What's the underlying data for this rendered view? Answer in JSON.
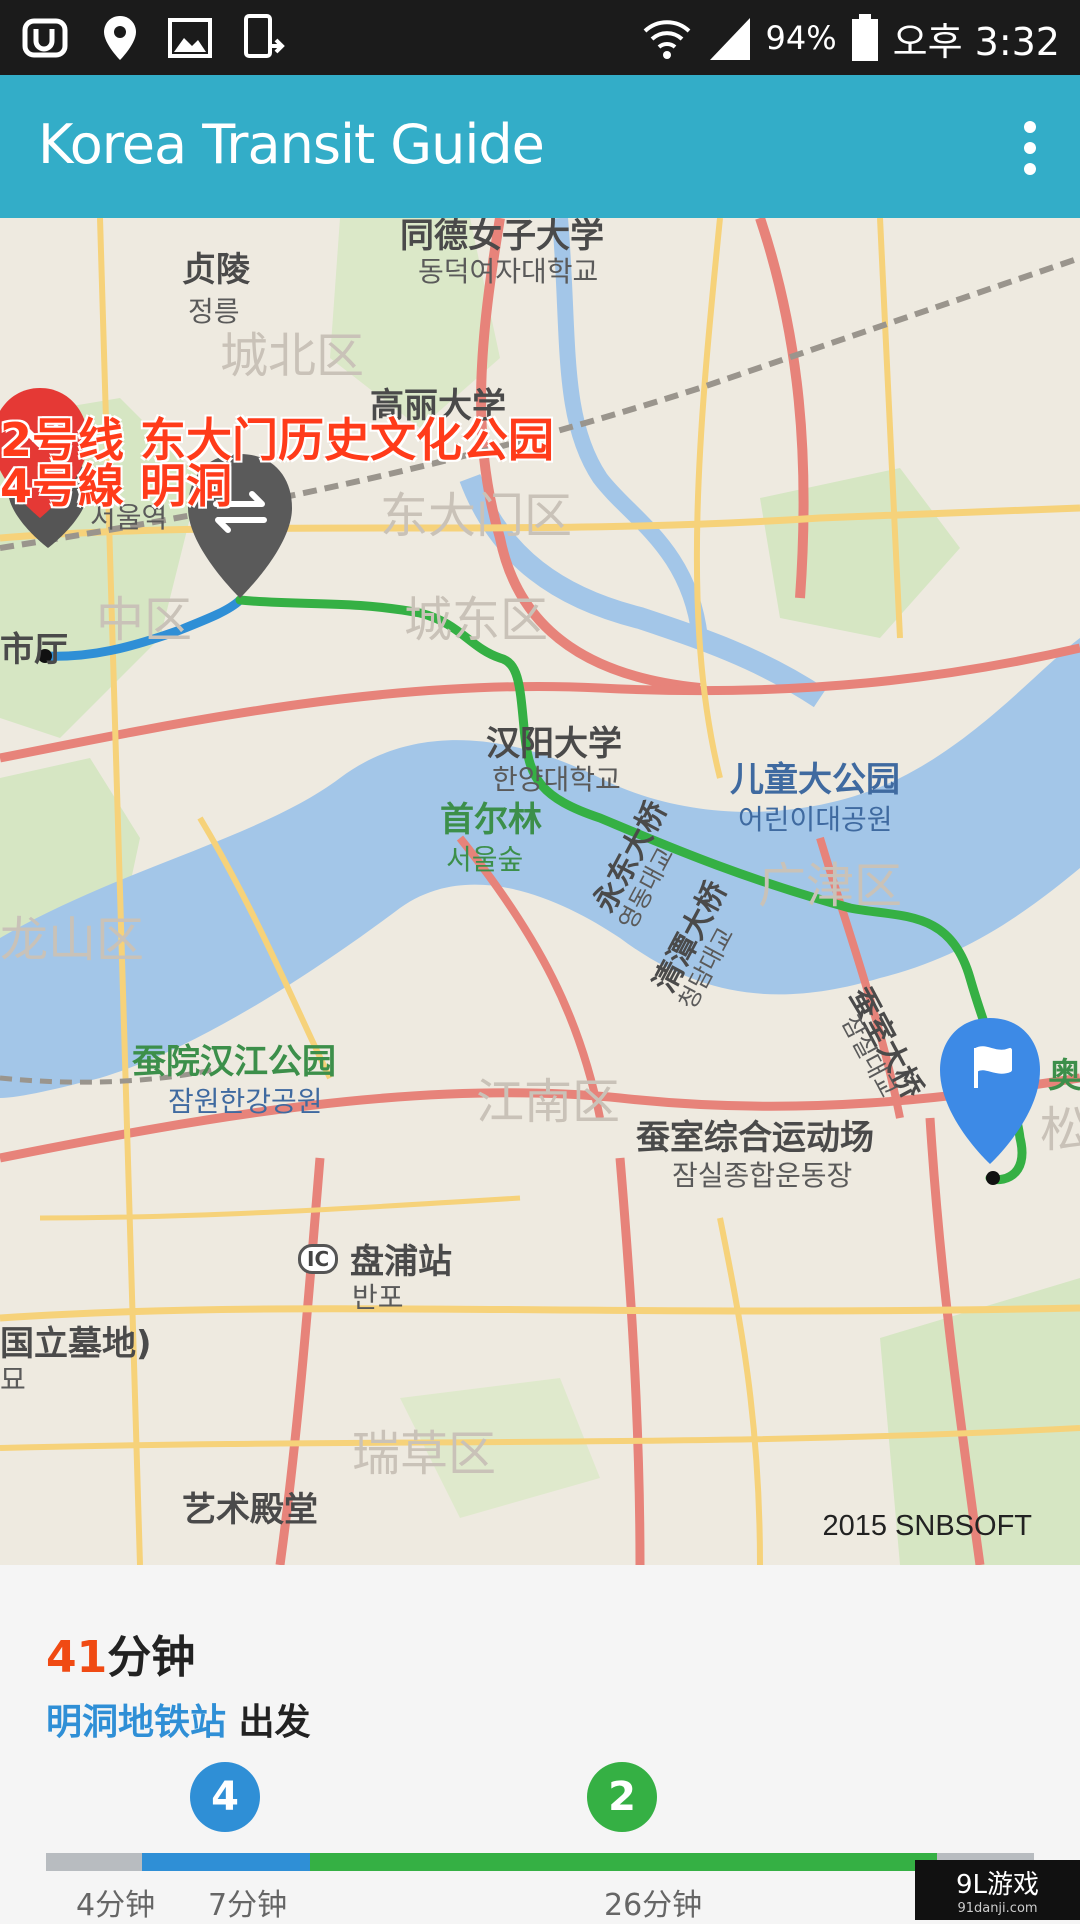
{
  "status_bar": {
    "battery": "94%",
    "time": "오후 3:32",
    "left_icons": [
      "app-icon",
      "location-icon",
      "gallery-icon",
      "phone-transfer-icon"
    ],
    "right_icons": [
      "wifi-icon",
      "signal-icon",
      "battery-icon"
    ]
  },
  "app_bar": {
    "title": "Korea Transit Guide",
    "menu_icon": "overflow-menu-icon"
  },
  "map": {
    "overlay_line1": "2号线 东大门历史文化公园",
    "overlay_line2": "4号線 明洞",
    "copyright": "2015 SNBSOFT",
    "labels": {
      "zhenling_cn": "贞陵",
      "zhenling_kr": "정릉",
      "dongduk_cn": "同德女子大学",
      "dongduk_kr": "동덕여자대학교",
      "seongbuk": "城北区",
      "korea_univ": "高丽大学",
      "dongdaemun": "东大门区",
      "seoul_station_kr": "서울역",
      "jung_gu": "中区",
      "seongdong": "城东区",
      "station_end": "市厅",
      "hanyang_cn": "汉阳大学",
      "hanyang_kr": "한양대학교",
      "seoul_forest_cn": "首尔林",
      "seoul_forest_kr": "서울숲",
      "childrens_park_cn": "儿童大公园",
      "childrens_park_kr": "어린이대공원",
      "gwangjin": "广津区",
      "yongsan": "龙山区",
      "jamwon_cn": "蚕院汉江公园",
      "jamwon_kr": "잠원한강공원",
      "gangnam": "江南区",
      "jamsil_stadium_cn": "蚕室综合运动场",
      "jamsil_stadium_kr": "잠실종합운동장",
      "banpo_cn": "盘浦站",
      "banpo_kr": "반포",
      "ic": "IC",
      "cemetery_cn": "国立墓地)",
      "cemetery_kr": "묘",
      "seocho": "瑞草区",
      "arts_center": "艺术殿堂",
      "songpa": "松坡",
      "olympic": "奥",
      "youngdong_bridge_cn": "永东大桥",
      "youngdong_bridge_kr": "영동대교",
      "cheongdam_bridge_cn": "清潭大桥",
      "cheongdam_bridge_kr": "청담대교",
      "jamsil_bridge_cn": "蚕室大桥",
      "jamsil_bridge_kr": "잠실대교"
    }
  },
  "summary": {
    "duration_number": "41",
    "duration_unit": "分钟",
    "depart_station": "明洞地铁站",
    "depart_suffix": " 出发"
  },
  "lines": [
    {
      "name": "4",
      "color": "#2f8fd6"
    },
    {
      "name": "2",
      "color": "#35b044"
    }
  ],
  "timeline": [
    {
      "label": "4分钟",
      "minutes": 4,
      "color": "#b8bcc0"
    },
    {
      "label": "7分钟",
      "minutes": 7,
      "color": "#2f8fd6"
    },
    {
      "label": "26分钟",
      "minutes": 26,
      "color": "#35b044"
    },
    {
      "label": "",
      "minutes": 4,
      "color": "#b8bcc0"
    }
  ],
  "watermark": {
    "main": "9L游戏",
    "sub": "91danji.com"
  }
}
